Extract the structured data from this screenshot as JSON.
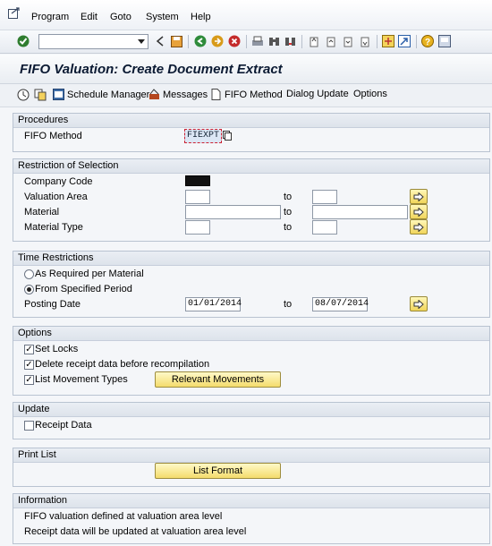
{
  "menu": {
    "items": [
      "Program",
      "Edit",
      "Goto",
      "System",
      "Help"
    ]
  },
  "toolbar": {
    "command_value": ""
  },
  "title": "FIFO Valuation: Create Document Extract",
  "app_toolbar": {
    "schedule_manager": "Schedule Manager",
    "messages": "Messages",
    "fifo_method": "FIFO Method",
    "dialog_update": "Dialog Update",
    "options": "Options"
  },
  "procedures": {
    "header": "Procedures",
    "fifo_method_label": "FIFO Method",
    "fifo_method_value": "FIEXPT"
  },
  "restriction": {
    "header": "Restriction of Selection",
    "company_code_label": "Company Code",
    "company_code_value": "",
    "valuation_area_label": "Valuation Area",
    "material_label": "Material",
    "material_type_label": "Material Type",
    "to_label": "to"
  },
  "time": {
    "header": "Time Restrictions",
    "option1": "As Required per Material",
    "option2": "From Specified Period",
    "posting_date_label": "Posting Date",
    "from_date": "01/01/2014",
    "to_label": "to",
    "to_date": "08/07/2014"
  },
  "options": {
    "header": "Options",
    "set_locks": "Set Locks",
    "delete_receipt": "Delete receipt data before recompilation",
    "list_movement": "List Movement Types",
    "relevant_movements": "Relevant Movements"
  },
  "update": {
    "header": "Update",
    "receipt_data": "Receipt Data"
  },
  "print_list": {
    "header": "Print List",
    "list_format": "List Format"
  },
  "information": {
    "header": "Information",
    "line1": "FIFO valuation defined at valuation area level",
    "line2": "Receipt data will be updated at valuation area level"
  }
}
